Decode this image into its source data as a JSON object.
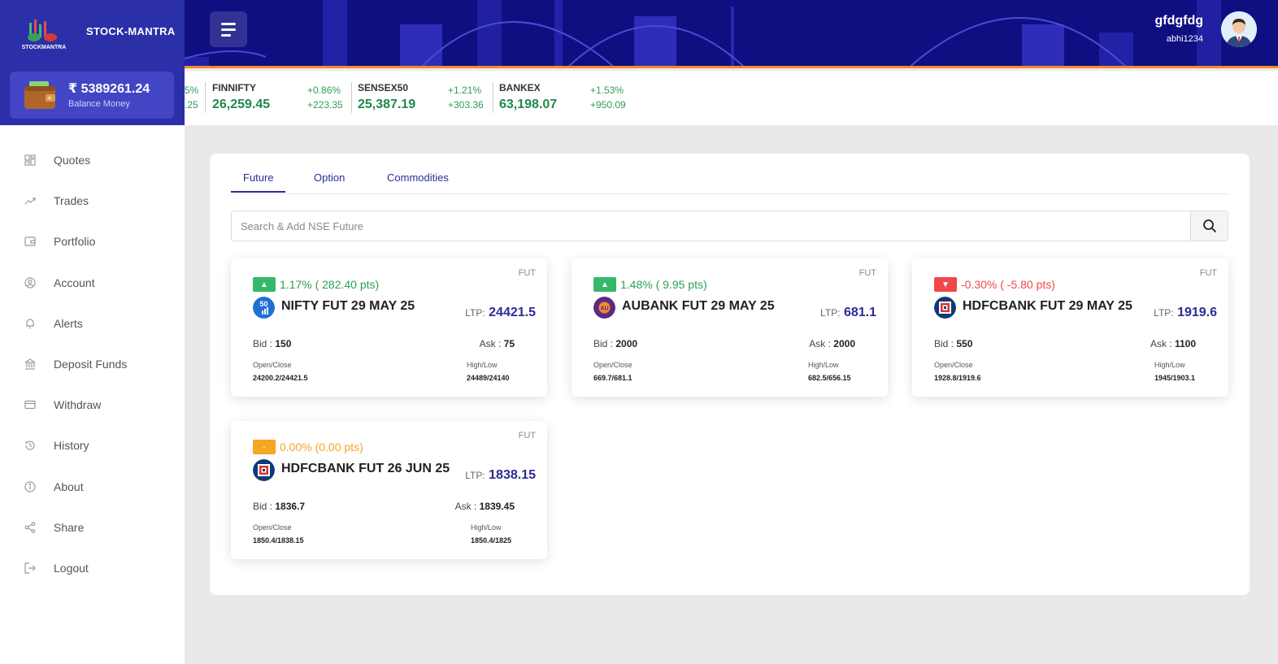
{
  "colors": {
    "brand": "#2b2fa8",
    "header": "#100f82",
    "accent": "#f08a2a",
    "up": "#2e9e56",
    "down": "#f04848",
    "flat": "#f5a623",
    "ltp": "#2c2c96"
  },
  "brand": {
    "name": "STOCK-MANTRA",
    "logo_text": "STOCKMANTRA"
  },
  "wallet": {
    "balance": "₹ 5389261.24",
    "label": "Balance Money"
  },
  "sidebar": {
    "items": [
      {
        "label": "Quotes",
        "icon": "grid-icon"
      },
      {
        "label": "Trades",
        "icon": "trend-icon"
      },
      {
        "label": "Portfolio",
        "icon": "wallet-icon"
      },
      {
        "label": "Account",
        "icon": "user-circle-icon"
      },
      {
        "label": "Alerts",
        "icon": "bell-icon"
      },
      {
        "label": "Deposit Funds",
        "icon": "bank-icon"
      },
      {
        "label": "Withdraw",
        "icon": "card-icon"
      },
      {
        "label": "History",
        "icon": "history-icon"
      },
      {
        "label": "About",
        "icon": "info-icon"
      },
      {
        "label": "Share",
        "icon": "share-icon"
      },
      {
        "label": "Logout",
        "icon": "logout-icon"
      }
    ]
  },
  "header": {
    "user_name": "gfdgfdg",
    "user_id": "abhi1234"
  },
  "ticker": {
    "partial": {
      "pct": "5%",
      "pts": ".25"
    },
    "items": [
      {
        "name": "FINNIFTY",
        "price": "26,259.45",
        "pct": "+0.86%",
        "pts": "+223.35"
      },
      {
        "name": "SENSEX50",
        "price": "25,387.19",
        "pct": "+1.21%",
        "pts": "+303.36"
      },
      {
        "name": "BANKEX",
        "price": "63,198.07",
        "pct": "+1.53%",
        "pts": "+950.09"
      }
    ]
  },
  "tabs": [
    "Future",
    "Option",
    "Commodities"
  ],
  "search": {
    "placeholder": "Search & Add NSE Future"
  },
  "labels": {
    "fut": "FUT",
    "ltp": "LTP:",
    "bid": "Bid :",
    "ask": "Ask :",
    "open_close": "Open/Close",
    "high_low": "High/Low"
  },
  "cards": [
    {
      "direction": "up",
      "badge": "▲",
      "pct": "1.17%",
      "pts": "( 282.40 pts)",
      "name": "NIFTY FUT 29 MAY 25",
      "icon": "nifty-50-icon",
      "icon_text": "50",
      "ltp": "24421.5",
      "bid": "150",
      "ask": "75",
      "open_close": "24200.2/24421.5",
      "high_low": "24489/24140"
    },
    {
      "direction": "up",
      "badge": "▲",
      "pct": "1.48%",
      "pts": "( 9.95 pts)",
      "name": "AUBANK FUT 29 MAY 25",
      "icon": "aubank-icon",
      "icon_text": "AU",
      "ltp": "681.1",
      "bid": "2000",
      "ask": "2000",
      "open_close": "669.7/681.1",
      "high_low": "682.5/656.15"
    },
    {
      "direction": "down",
      "badge": "▼",
      "pct": "-0.30%",
      "pts": "( -5.80 pts)",
      "name": "HDFCBANK FUT 29 MAY 25",
      "icon": "hdfcbank-icon",
      "icon_text": "",
      "ltp": "1919.6",
      "bid": "550",
      "ask": "1100",
      "open_close": "1928.8/1919.6",
      "high_low": "1945/1903.1"
    },
    {
      "direction": "flat",
      "badge": "-",
      "pct": "0.00%",
      "pts": "(0.00 pts)",
      "name": "HDFCBANK FUT 26 JUN 25",
      "icon": "hdfcbank-icon",
      "icon_text": "",
      "ltp": "1838.15",
      "bid": "1836.7",
      "ask": "1839.45",
      "open_close": "1850.4/1838.15",
      "high_low": "1850.4/1825"
    }
  ]
}
